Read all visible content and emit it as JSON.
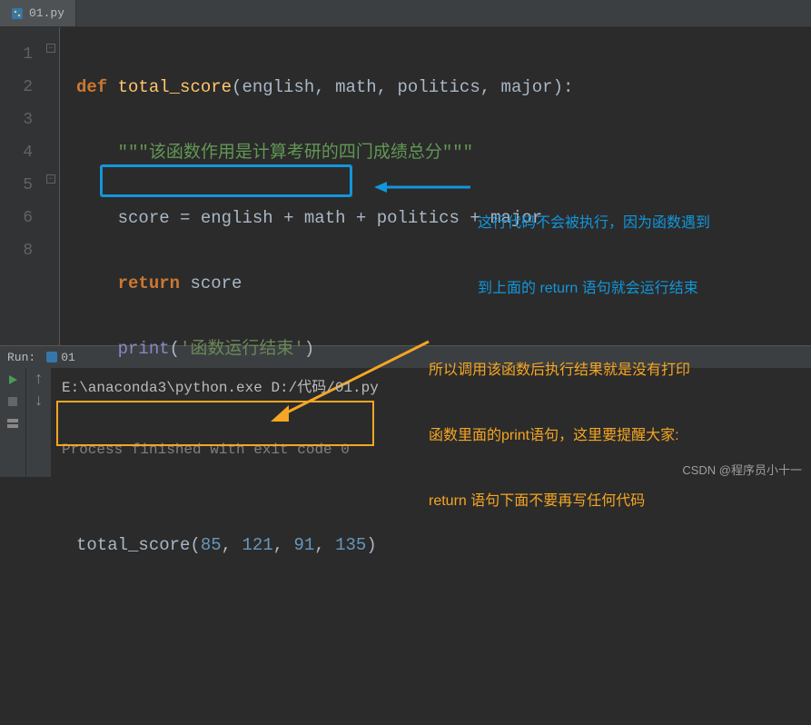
{
  "tab": {
    "label": "01.py",
    "icon": "python-file-icon"
  },
  "gutter": {
    "lines": [
      "1",
      "2",
      "3",
      "4",
      "5",
      "6",
      "",
      "8"
    ]
  },
  "code": {
    "def": "def",
    "fn_name": "total_score",
    "params": {
      "p1": "english",
      "p2": "math",
      "p3": "politics",
      "p4": "major"
    },
    "docstring": "\"\"\"该函数作用是计算考研的四门成绩总分\"\"\"",
    "assign_lhs": "score",
    "assign_eq": "=",
    "assign_rhs": {
      "a": "english",
      "b": "math",
      "c": "politics",
      "d": "major",
      "plus": "+"
    },
    "return_kw": "return",
    "return_val": "score",
    "print_fn": "print",
    "print_arg": "'函数运行结束'",
    "call_fn": "total_score",
    "call_args": {
      "a1": "85",
      "a2": "121",
      "a3": "91",
      "a4": "135"
    }
  },
  "annotations": {
    "blue_line1": "这行代码不会被执行，因为函数遇到",
    "blue_line2": "到上面的 return 语句就会运行结束",
    "orange_line1": "所以调用该函数后执行结果就是没有打印",
    "orange_line2": "函数里面的print语句，这里要提醒大家:",
    "orange_line3": "return 语句下面不要再写任何代码"
  },
  "run": {
    "header_label": "Run:",
    "tab_label": "01",
    "cmd": "E:\\anaconda3\\python.exe D:/代码/01.py",
    "separator": "",
    "finished": "Process finished with exit code 0"
  },
  "watermark": "CSDN @程序员小十一"
}
